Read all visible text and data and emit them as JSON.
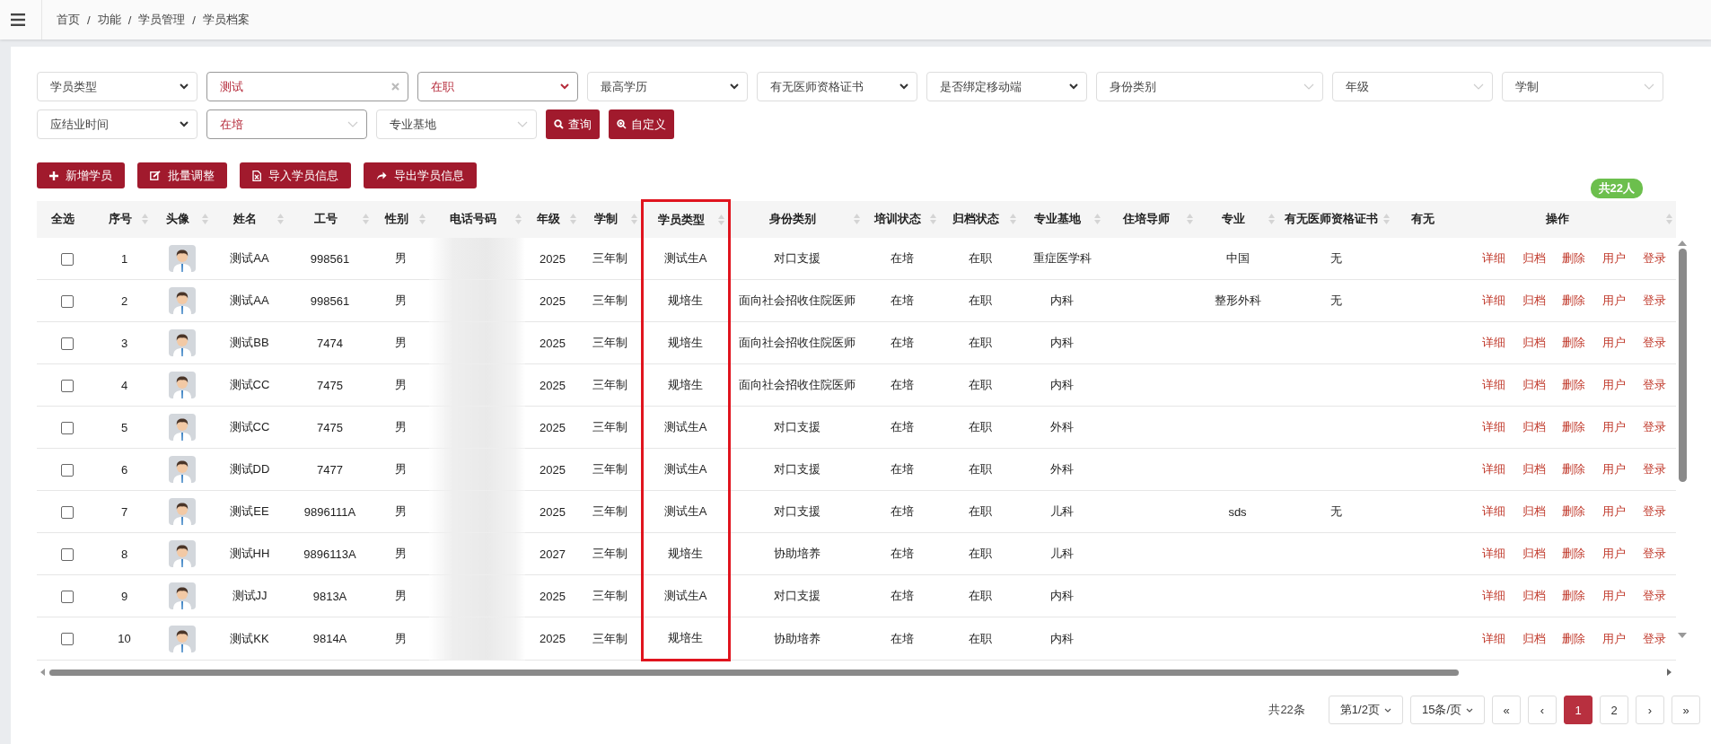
{
  "breadcrumb": {
    "items": [
      "首页",
      "功能",
      "学员管理",
      "学员档案"
    ],
    "separator": "/"
  },
  "filters": [
    {
      "kind": "select",
      "placeholder": "学员类型"
    },
    {
      "kind": "input",
      "value": "测试"
    },
    {
      "kind": "select",
      "value": "在职"
    },
    {
      "kind": "select",
      "placeholder": "最高学历"
    },
    {
      "kind": "select",
      "placeholder": "有无医师资格证书"
    },
    {
      "kind": "select",
      "placeholder": "是否绑定移动端"
    },
    {
      "kind": "combo",
      "placeholder": "身份类别"
    },
    {
      "kind": "combo",
      "placeholder": "年级"
    },
    {
      "kind": "combo",
      "placeholder": "学制"
    },
    {
      "kind": "select",
      "placeholder": "应结业时间"
    },
    {
      "kind": "combo",
      "value": "在培"
    },
    {
      "kind": "combo",
      "placeholder": "专业基地"
    }
  ],
  "filter_buttons": [
    {
      "kind": "search",
      "label": "查询"
    },
    {
      "kind": "custom",
      "label": "自定义"
    }
  ],
  "toolbar": [
    {
      "kind": "add",
      "label": "新增学员"
    },
    {
      "kind": "edit",
      "label": "批量调整"
    },
    {
      "kind": "import",
      "label": "导入学员信息"
    },
    {
      "kind": "export",
      "label": "导出学员信息"
    }
  ],
  "total_badge": "共22人",
  "table": {
    "columns": [
      {
        "label": "全选",
        "sortable": false,
        "highlighted": false
      },
      {
        "label": "序号",
        "sortable": true,
        "highlighted": false
      },
      {
        "label": "头像",
        "sortable": true,
        "highlighted": false
      },
      {
        "label": "姓名",
        "sortable": true,
        "highlighted": false
      },
      {
        "label": "工号",
        "sortable": true,
        "highlighted": false
      },
      {
        "label": "性别",
        "sortable": true,
        "highlighted": false
      },
      {
        "label": "电话号码",
        "sortable": true,
        "highlighted": false
      },
      {
        "label": "年级",
        "sortable": true,
        "highlighted": false
      },
      {
        "label": "学制",
        "sortable": true,
        "highlighted": false
      },
      {
        "label": "学员类型",
        "sortable": true,
        "highlighted": true
      },
      {
        "label": "身份类别",
        "sortable": true,
        "highlighted": false
      },
      {
        "label": "培训状态",
        "sortable": true,
        "highlighted": false
      },
      {
        "label": "归档状态",
        "sortable": true,
        "highlighted": false
      },
      {
        "label": "专业基地",
        "sortable": true,
        "highlighted": false
      },
      {
        "label": "住培导师",
        "sortable": true,
        "highlighted": false
      },
      {
        "label": "专业",
        "sortable": true,
        "highlighted": false
      },
      {
        "label": "有无医师资格证书",
        "sortable": true,
        "highlighted": false
      },
      {
        "label": "有无",
        "sortable": false,
        "highlighted": false
      },
      {
        "label": "操作",
        "sortable": true,
        "highlighted": false
      }
    ],
    "rows": [
      {
        "checked": false,
        "cells": [
          "",
          "1",
          "",
          "测试AA",
          "998561",
          "男",
          "",
          "2025",
          "三年制",
          "测试生A",
          "对口支援",
          "在培",
          "在职",
          "重症医学科",
          "",
          "中国",
          "无",
          ""
        ],
        "actions": [
          "详细",
          "归档",
          "删除",
          "用户",
          "登录"
        ]
      },
      {
        "checked": false,
        "cells": [
          "",
          "2",
          "",
          "测试AA",
          "998561",
          "男",
          "",
          "2025",
          "三年制",
          "规培生",
          "面向社会招收住院医师",
          "在培",
          "在职",
          "内科",
          "",
          "整形外科",
          "无",
          ""
        ],
        "actions": [
          "详细",
          "归档",
          "删除",
          "用户",
          "登录"
        ]
      },
      {
        "checked": false,
        "cells": [
          "",
          "3",
          "",
          "测试BB",
          "7474",
          "男",
          "",
          "2025",
          "三年制",
          "规培生",
          "面向社会招收住院医师",
          "在培",
          "在职",
          "内科",
          "",
          "",
          "",
          ""
        ],
        "actions": [
          "详细",
          "归档",
          "删除",
          "用户",
          "登录"
        ]
      },
      {
        "checked": false,
        "cells": [
          "",
          "4",
          "",
          "测试CC",
          "7475",
          "男",
          "",
          "2025",
          "三年制",
          "规培生",
          "面向社会招收住院医师",
          "在培",
          "在职",
          "内科",
          "",
          "",
          "",
          ""
        ],
        "actions": [
          "详细",
          "归档",
          "删除",
          "用户",
          "登录"
        ]
      },
      {
        "checked": false,
        "cells": [
          "",
          "5",
          "",
          "测试CC",
          "7475",
          "男",
          "",
          "2025",
          "三年制",
          "测试生A",
          "对口支援",
          "在培",
          "在职",
          "外科",
          "",
          "",
          "",
          ""
        ],
        "actions": [
          "详细",
          "归档",
          "删除",
          "用户",
          "登录"
        ]
      },
      {
        "checked": false,
        "cells": [
          "",
          "6",
          "",
          "测试DD",
          "7477",
          "男",
          "",
          "2025",
          "三年制",
          "测试生A",
          "对口支援",
          "在培",
          "在职",
          "外科",
          "",
          "",
          "",
          ""
        ],
        "actions": [
          "详细",
          "归档",
          "删除",
          "用户",
          "登录"
        ]
      },
      {
        "checked": false,
        "cells": [
          "",
          "7",
          "",
          "测试EE",
          "9896111A",
          "男",
          "",
          "2025",
          "三年制",
          "测试生A",
          "对口支援",
          "在培",
          "在职",
          "儿科",
          "",
          "sds",
          "无",
          ""
        ],
        "actions": [
          "详细",
          "归档",
          "删除",
          "用户",
          "登录"
        ]
      },
      {
        "checked": false,
        "cells": [
          "",
          "8",
          "",
          "测试HH",
          "9896113A",
          "男",
          "",
          "2027",
          "三年制",
          "规培生",
          "协助培养",
          "在培",
          "在职",
          "儿科",
          "",
          "",
          "",
          ""
        ],
        "actions": [
          "详细",
          "归档",
          "删除",
          "用户",
          "登录"
        ]
      },
      {
        "checked": false,
        "cells": [
          "",
          "9",
          "",
          "测试JJ",
          "9813A",
          "男",
          "",
          "2025",
          "三年制",
          "测试生A",
          "对口支援",
          "在培",
          "在职",
          "内科",
          "",
          "",
          "",
          ""
        ],
        "actions": [
          "详细",
          "归档",
          "删除",
          "用户",
          "登录"
        ]
      },
      {
        "checked": false,
        "cells": [
          "",
          "10",
          "",
          "测试KK",
          "9814A",
          "男",
          "",
          "2025",
          "三年制",
          "规培生",
          "协助培养",
          "在培",
          "在职",
          "内科",
          "",
          "",
          "",
          ""
        ],
        "actions": [
          "详细",
          "归档",
          "删除",
          "用户",
          "登录"
        ]
      }
    ]
  },
  "pagination": {
    "total": "共22条",
    "page_select": "第1/2页",
    "size_select": "15条/页",
    "first": "«",
    "prev": "‹",
    "pages": [
      {
        "label": "1",
        "selected": true
      },
      {
        "label": "2",
        "selected": false
      }
    ],
    "next": "›",
    "last": "»"
  }
}
